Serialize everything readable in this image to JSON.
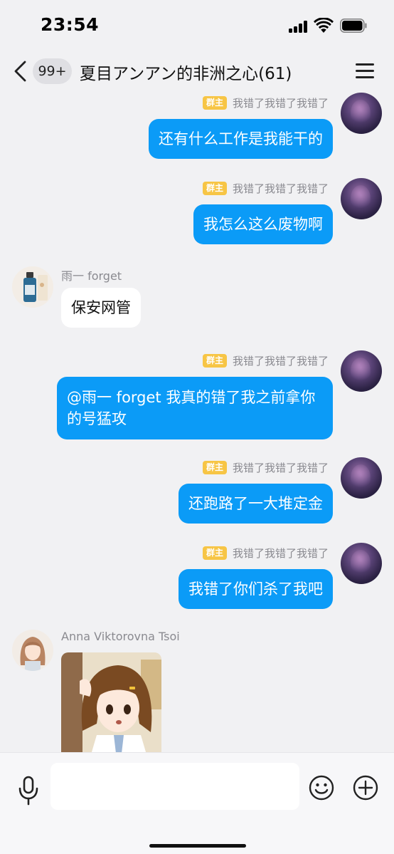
{
  "status_bar": {
    "time": "23:54"
  },
  "nav": {
    "unread_badge": "99+",
    "title": "夏目アンアン的非洲之心(61)"
  },
  "owner_tag": "群主",
  "self_name": "我错了我错了我错了",
  "messages": [
    {
      "direction": "out",
      "text": "还有什么工作是我能干的"
    },
    {
      "direction": "out",
      "text": "我怎么这么废物啊"
    },
    {
      "direction": "in",
      "sender": "雨一 forget",
      "text": "保安网管"
    },
    {
      "direction": "out",
      "text": "@雨一 forget 我真的错了我之前拿你的号猛攻"
    },
    {
      "direction": "out",
      "text": "还跑路了一大堆定金"
    },
    {
      "direction": "out",
      "text": "我错了你们杀了我吧"
    },
    {
      "direction": "in",
      "sender": "Anna Viktorovna Tsoi",
      "type": "image"
    }
  ],
  "input": {
    "placeholder": "",
    "value": ""
  },
  "colors": {
    "bubble_out": "#0b9bf7",
    "bubble_in": "#ffffff",
    "owner_tag": "#f7c545",
    "background": "#f1f1f3"
  },
  "icons": [
    "back-icon",
    "menu-icon",
    "mic-icon",
    "emoji-icon",
    "plus-icon",
    "signal-icon",
    "wifi-icon",
    "battery-icon"
  ]
}
